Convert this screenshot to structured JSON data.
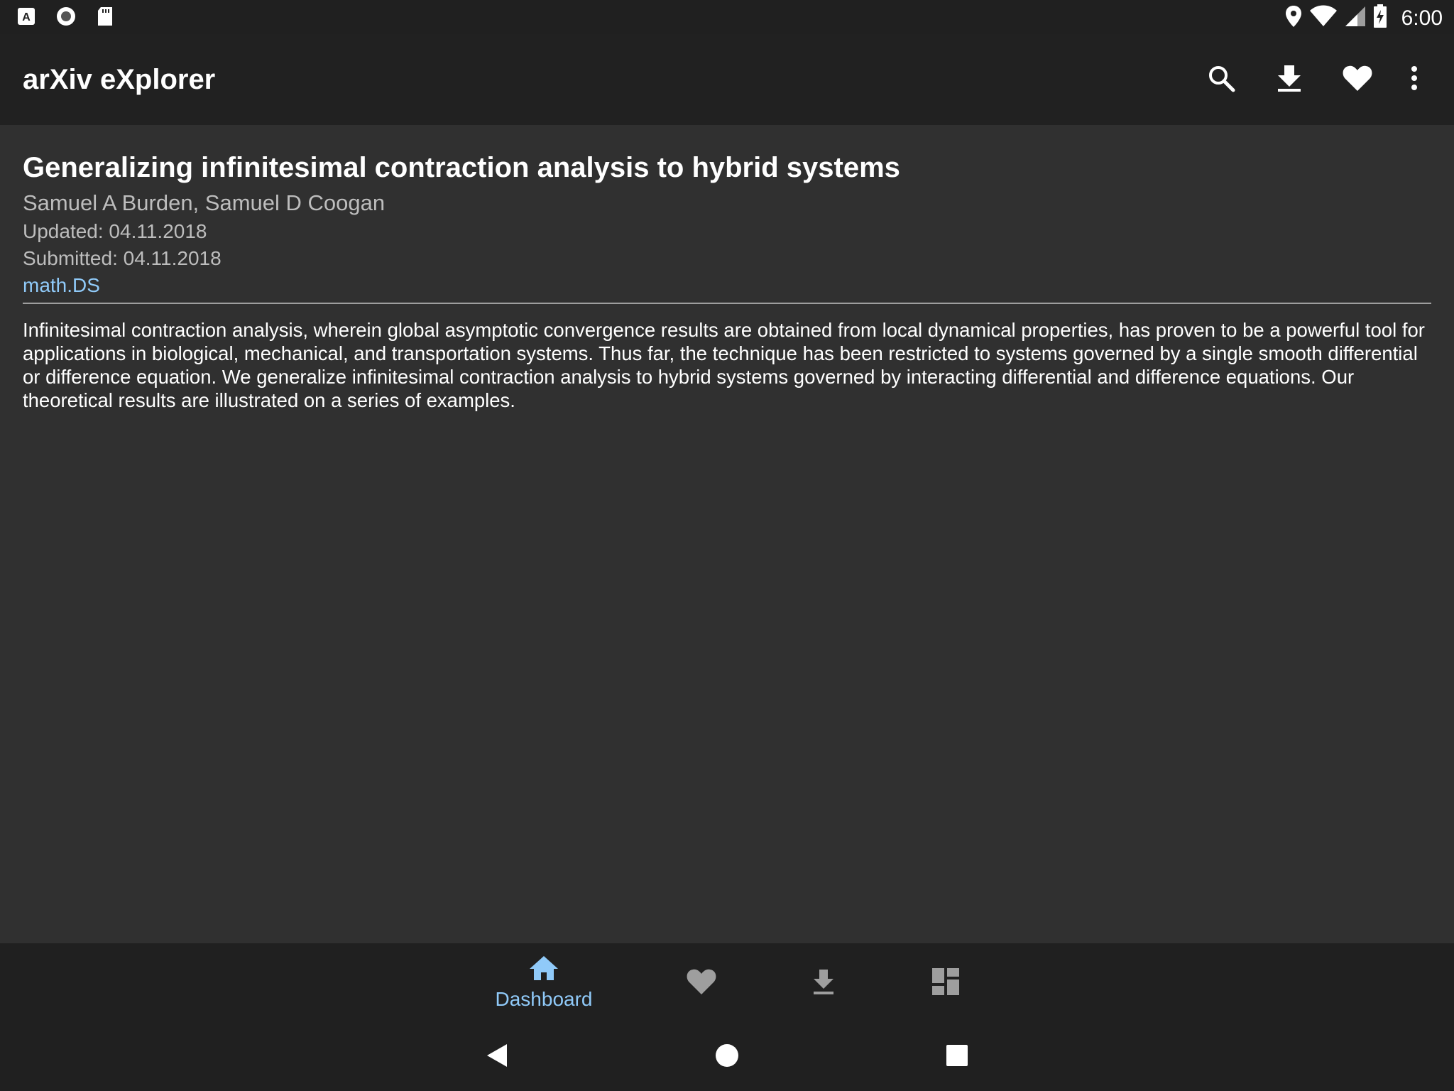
{
  "status_bar": {
    "time": "6:00",
    "left_icons": [
      "a-notification-icon",
      "circle-notification-icon",
      "sd-card-icon"
    ],
    "right_icons": [
      "location-icon",
      "wifi-icon",
      "signal-icon",
      "battery-charging-icon"
    ]
  },
  "app_bar": {
    "title": "arXiv eXplorer",
    "actions": [
      "search-icon",
      "download-icon",
      "favorite-icon",
      "more-vert-icon"
    ]
  },
  "paper": {
    "title": "Generalizing infinitesimal contraction analysis to hybrid systems",
    "authors": "Samuel A Burden, Samuel D Coogan",
    "updated": "Updated: 04.11.2018",
    "submitted": "Submitted: 04.11.2018",
    "category": "math.DS",
    "abstract": "Infinitesimal contraction analysis, wherein global asymptotic convergence results are obtained from local dynamical properties, has proven to be a powerful tool for applications in biological, mechanical, and transportation systems. Thus far, the technique has been restricted to systems governed by a single smooth differential or difference equation. We generalize infinitesimal contraction analysis to hybrid systems governed by interacting differential and difference equations. Our theoretical results are illustrated on a series of examples."
  },
  "bottom_nav": {
    "items": [
      {
        "label": "Dashboard",
        "icon": "home-icon",
        "selected": true
      },
      {
        "label": "",
        "icon": "favorite-icon",
        "selected": false
      },
      {
        "label": "",
        "icon": "download-icon",
        "selected": false
      },
      {
        "label": "",
        "icon": "dashboard-grid-icon",
        "selected": false
      }
    ]
  },
  "colors": {
    "background": "#303030",
    "app_bar": "#212121",
    "accent": "#90caf9",
    "secondary_text": "#bdbdbd",
    "inactive_icon": "#9e9e9e"
  }
}
